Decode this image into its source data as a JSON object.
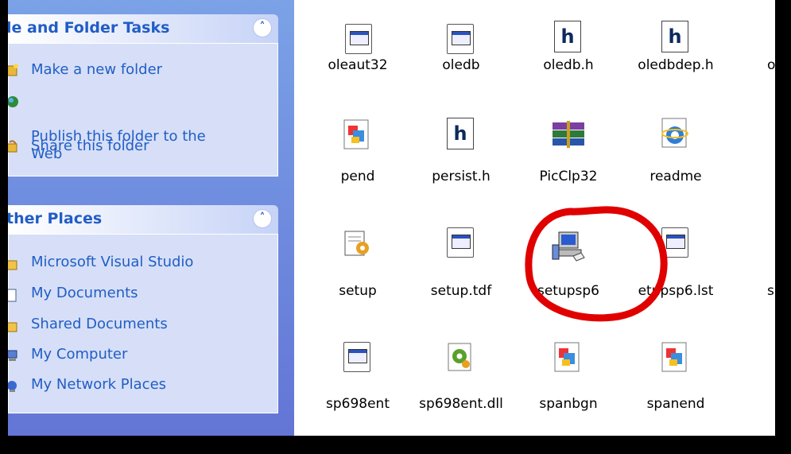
{
  "file_tasks": {
    "title": "le and Folder Tasks",
    "collapse_glyph": "˄",
    "items": [
      {
        "label": "Make a new folder",
        "icon": "new-folder-icon"
      },
      {
        "label": "Publish this folder to the\nWeb",
        "icon": "publish-web-icon"
      },
      {
        "label": "Share this folder",
        "icon": "share-folder-icon"
      }
    ]
  },
  "other_places": {
    "title": "ther Places",
    "collapse_glyph": "˄",
    "items": [
      {
        "label": "Microsoft Visual Studio",
        "icon": "folder-icon"
      },
      {
        "label": "My Documents",
        "icon": "my-documents-icon"
      },
      {
        "label": "Shared Documents",
        "icon": "folder-icon"
      },
      {
        "label": "My Computer",
        "icon": "my-computer-icon"
      },
      {
        "label": "My Network Places",
        "icon": "network-places-icon"
      }
    ]
  },
  "files": [
    {
      "name": "oleaut32",
      "icon": "generic-doc-icon"
    },
    {
      "name": "oledb",
      "icon": "generic-doc-icon"
    },
    {
      "name": "oledb.h",
      "icon": "h-header-icon"
    },
    {
      "name": "oledbdep.h",
      "icon": "h-header-icon"
    },
    {
      "name": "o",
      "icon": "generic-doc-icon"
    },
    {
      "name": "pend",
      "icon": "media-doc-icon"
    },
    {
      "name": "persist.h",
      "icon": "h-header-icon"
    },
    {
      "name": "PicClp32",
      "icon": "winrar-archive-icon"
    },
    {
      "name": "readme",
      "icon": "internet-explorer-icon"
    },
    {
      "name": "setup",
      "icon": "setup-config-icon"
    },
    {
      "name": "setup.tdf",
      "icon": "generic-doc-icon"
    },
    {
      "name": "setupsp6",
      "icon": "installer-computer-icon"
    },
    {
      "name": "etupsp6.lst",
      "icon": "generic-doc-icon"
    },
    {
      "name": "si",
      "icon": "generic-doc-icon"
    },
    {
      "name": "sp698ent",
      "icon": "generic-doc-icon"
    },
    {
      "name": "sp698ent.dll",
      "icon": "dll-gear-icon"
    },
    {
      "name": "spanbgn",
      "icon": "media-doc-icon"
    },
    {
      "name": "spanend",
      "icon": "media-doc-icon"
    }
  ],
  "colors": {
    "taskpane": "#6f8ddf",
    "panel_body": "#d6dff7",
    "link": "#215dc6",
    "annotation": "#e00000"
  }
}
